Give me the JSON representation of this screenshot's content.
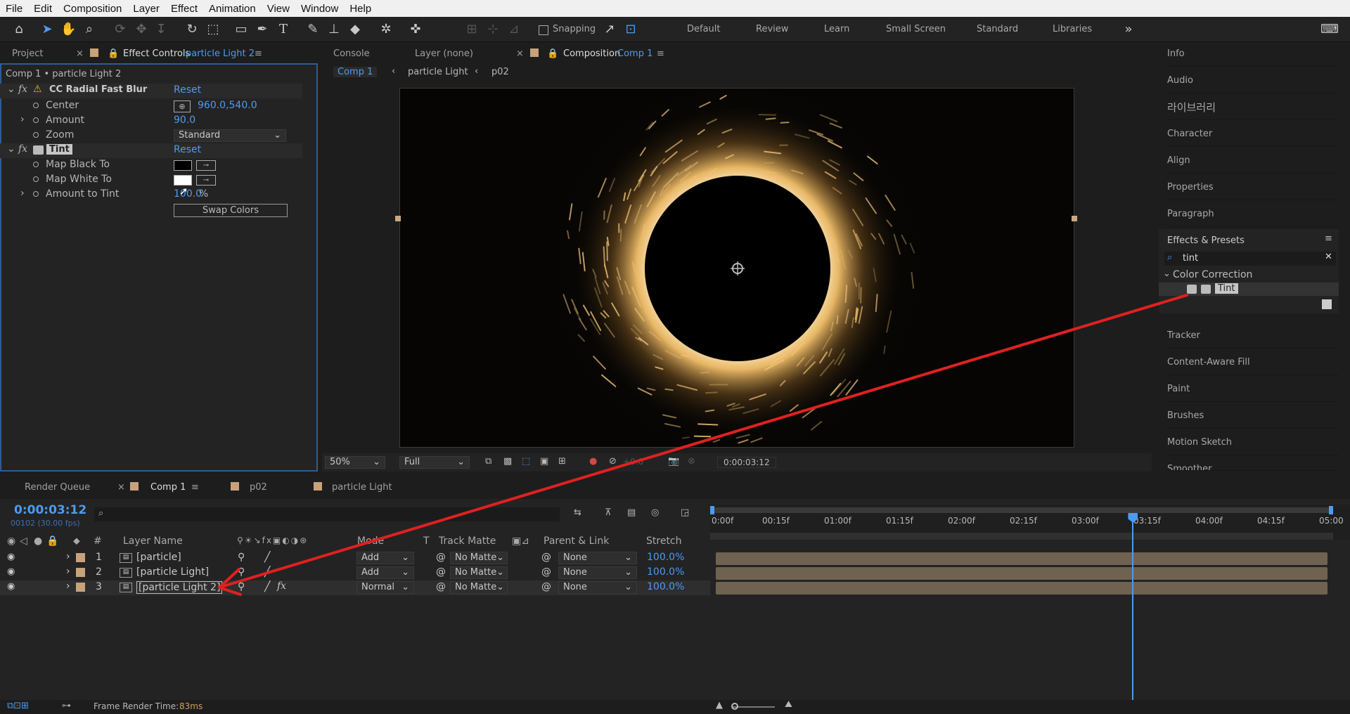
{
  "menu": [
    "File",
    "Edit",
    "Composition",
    "Layer",
    "Effect",
    "Animation",
    "View",
    "Window",
    "Help"
  ],
  "toolbar": {
    "snapping_label": "Snapping",
    "workspaces": [
      "Default",
      "Review",
      "Learn",
      "Small Screen",
      "Standard",
      "Libraries"
    ]
  },
  "effect_panel": {
    "tab_project": "Project",
    "tab_effect_controls": "Effect Controls",
    "tab_effect_controls_layer": "particle Light 2",
    "breadcrumb": "Comp 1 • particle Light 2",
    "effects": [
      {
        "name": "CC Radial Fast Blur",
        "reset": "Reset",
        "properties": [
          {
            "name": "Center",
            "value": "960.0,540.0"
          },
          {
            "name": "Amount",
            "value": "90.0"
          },
          {
            "name": "Zoom",
            "value": "Standard"
          }
        ]
      },
      {
        "name": "Tint",
        "reset": "Reset",
        "properties": [
          {
            "name": "Map Black To",
            "value": ""
          },
          {
            "name": "Map White To",
            "value": ""
          },
          {
            "name": "Amount to Tint",
            "value": "100.0",
            "unit": "%"
          }
        ],
        "swap_button": "Swap Colors"
      }
    ]
  },
  "comp_panel": {
    "tab_console": "Console",
    "tab_layer": "Layer (none)",
    "tab_composition": "Composition",
    "tab_composition_name": "Comp 1",
    "breadcrumbs": [
      "Comp 1",
      "particle Light",
      "p02"
    ],
    "zoom": "50%",
    "resolution": "Full",
    "exposure": "+0.0",
    "timecode": "0:00:03:12"
  },
  "right_panel": {
    "items_top": [
      "Info",
      "Audio",
      "라이브러리",
      "Character",
      "Align",
      "Properties",
      "Paragraph"
    ],
    "effects_presets": {
      "title": "Effects & Presets",
      "search_value": "tint",
      "category": "Color Correction",
      "result": "Tint"
    },
    "items_bottom": [
      "Tracker",
      "Content-Aware Fill",
      "Paint",
      "Brushes",
      "Motion Sketch",
      "Smoother"
    ]
  },
  "timeline": {
    "tab_render_queue": "Render Queue",
    "tab_comp": "Comp 1",
    "tab_p02": "p02",
    "tab_particle_light": "particle Light",
    "timecode": "0:00:03:12",
    "timecode_sub": "00102 (30.00 fps)",
    "headers": {
      "num": "#",
      "layer_name": "Layer Name",
      "mode": "Mode",
      "t": "T",
      "track_matte": "Track Matte",
      "parent": "Parent & Link",
      "stretch": "Stretch"
    },
    "ruler": [
      "0:00f",
      "00:15f",
      "01:00f",
      "01:15f",
      "02:00f",
      "02:15f",
      "03:00f",
      "03:15f",
      "04:00f",
      "04:15f",
      "05:00"
    ],
    "playhead_seconds": 3.4,
    "layers": [
      {
        "num": "1",
        "name": "[particle]",
        "mode": "Add",
        "matte": "No Matte",
        "parent": "None",
        "stretch": "100.0%"
      },
      {
        "num": "2",
        "name": "[particle Light]",
        "mode": "Add",
        "matte": "No Matte",
        "parent": "None",
        "stretch": "100.0%"
      },
      {
        "num": "3",
        "name": "[particle Light 2]",
        "mode": "Normal",
        "matte": "No Matte",
        "parent": "None",
        "stretch": "100.0%"
      }
    ],
    "status_label": "Frame Render Time:",
    "status_value": "83ms"
  },
  "colors": {
    "accent": "#4d9bf0",
    "arrow": "#e02020",
    "bar": "#6f6251"
  }
}
